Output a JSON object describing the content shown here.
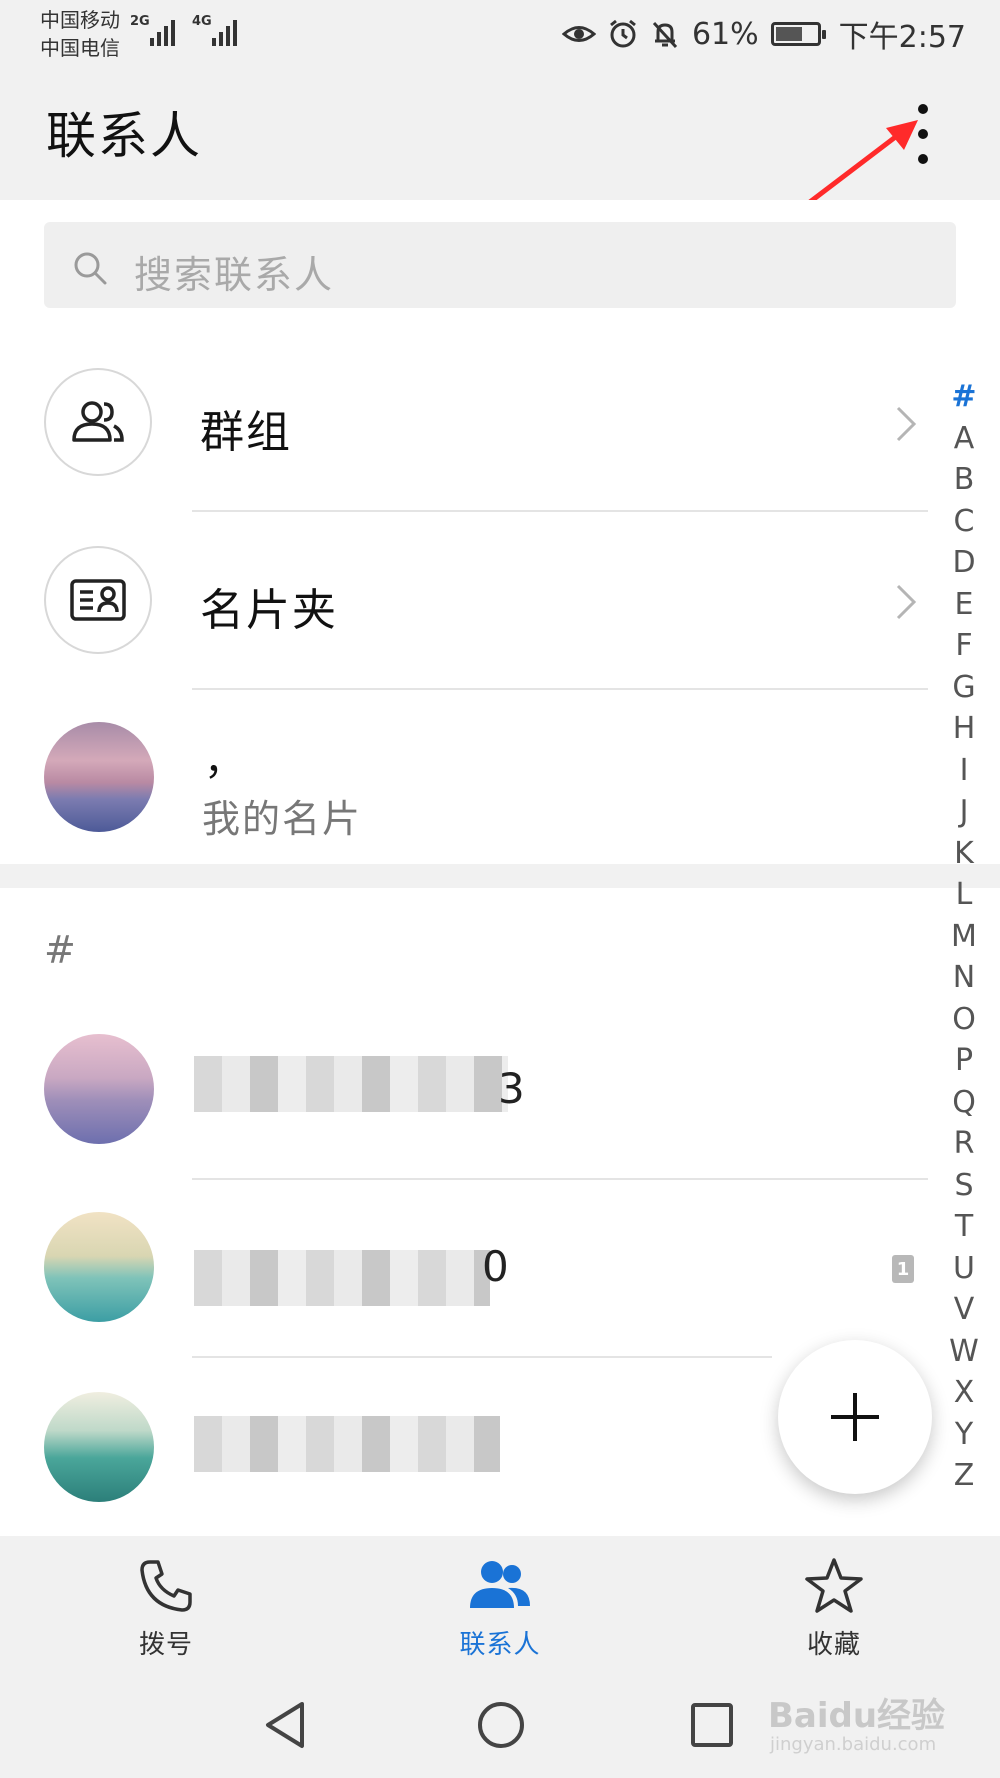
{
  "status_bar": {
    "carrier_1": "中国移动",
    "carrier_2": "中国电信",
    "net_1": "2G",
    "net_2": "4G",
    "battery": "61%",
    "time": "下午2:57"
  },
  "header": {
    "title": "联系人"
  },
  "search": {
    "placeholder": "搜索联系人"
  },
  "rows": {
    "groups_label": "群组",
    "cards_label": "名片夹",
    "my_card_name": "，",
    "my_card_label": "我的名片"
  },
  "contacts": {
    "section_header": "#",
    "items": [
      {
        "name_tail": "3"
      },
      {
        "name_tail": "0",
        "sim_badge": "1"
      },
      {
        "name_tail": ""
      }
    ]
  },
  "alphabet_index": [
    "#",
    "A",
    "B",
    "C",
    "D",
    "E",
    "F",
    "G",
    "H",
    "I",
    "J",
    "K",
    "L",
    "M",
    "N",
    "O",
    "P",
    "Q",
    "R",
    "S",
    "T",
    "U",
    "V",
    "W",
    "X",
    "Y",
    "Z"
  ],
  "bottom_nav": {
    "items": [
      {
        "label": "拨号",
        "icon": "phone-icon"
      },
      {
        "label": "联系人",
        "icon": "contacts-icon"
      },
      {
        "label": "收藏",
        "icon": "star-icon"
      }
    ]
  },
  "watermark": {
    "brand": "Baidu经验",
    "url": "jingyan.baidu.com"
  },
  "colors": {
    "accent": "#1a73d6",
    "annotation_arrow": "#ff2a2a"
  }
}
